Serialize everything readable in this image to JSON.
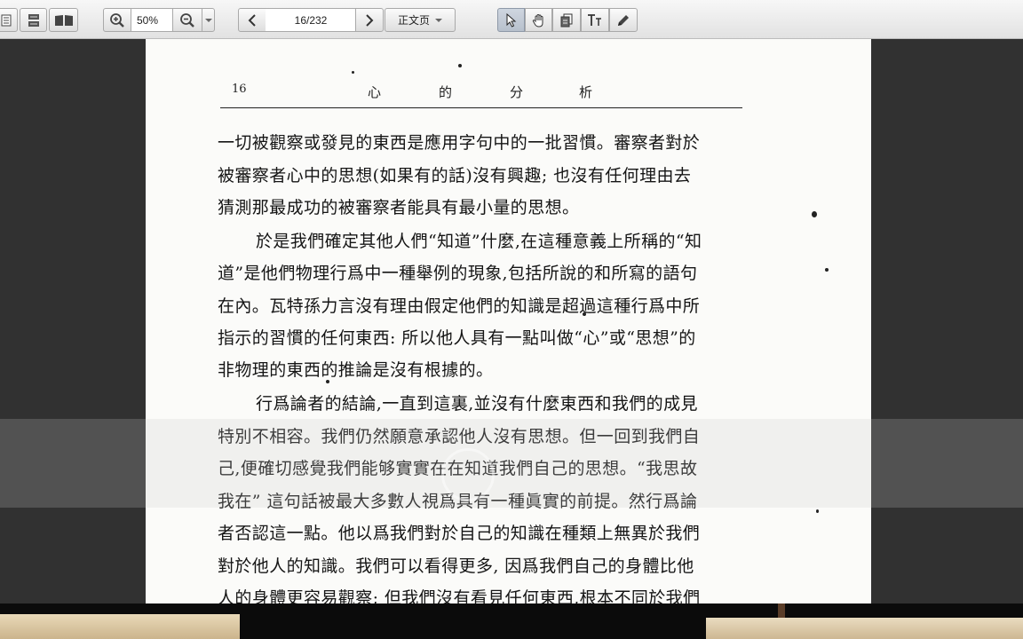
{
  "toolbar": {
    "zoom_value": "50%",
    "page_indicator": "16/232",
    "view_mode": "正文页"
  },
  "page": {
    "header": {
      "page_number": "16",
      "title_chars": [
        "心",
        "的",
        "分",
        "析"
      ]
    },
    "lines": [
      "一切被觀察或發見的東西是應用字句中的一批習慣。審察者對於",
      "被審察者心中的思想(如果有的話)沒有興趣; 也沒有任何理由去",
      "猜測那最成功的被審察者能具有最小量的思想。",
      "於是我們確定其他人們“知道”什麼,在這種意義上所稱的“知",
      "道”是他們物理行爲中一種舉例的現象,包括所說的和所寫的語句",
      "在內。瓦特孫力言沒有理由假定他們的知識是超過這種行爲中所",
      "指示的習慣的任何東西: 所以他人具有一點叫做“心”或“思想”的",
      "非物理的東西的推論是沒有根據的。",
      "行爲論者的結論,一直到這裏,並沒有什麼東西和我們的成見",
      "特別不相容。我們仍然願意承認他人沒有思想。但一回到我們自",
      "己,便確切感覺我們能够實實在在知道我們自己的思想。“我思故",
      "我在” 這句話被最大多數人視爲具有一種眞實的前提。然行爲論",
      "者否認這一點。他以爲我們對於自己的知識在種類上無異於我們",
      "對於他人的知識。我們可以看得更多, 因爲我們自己的身體比他",
      "人的身體更容易觀察; 但我們沒有看見任何東西,根本不同於我們"
    ]
  }
}
